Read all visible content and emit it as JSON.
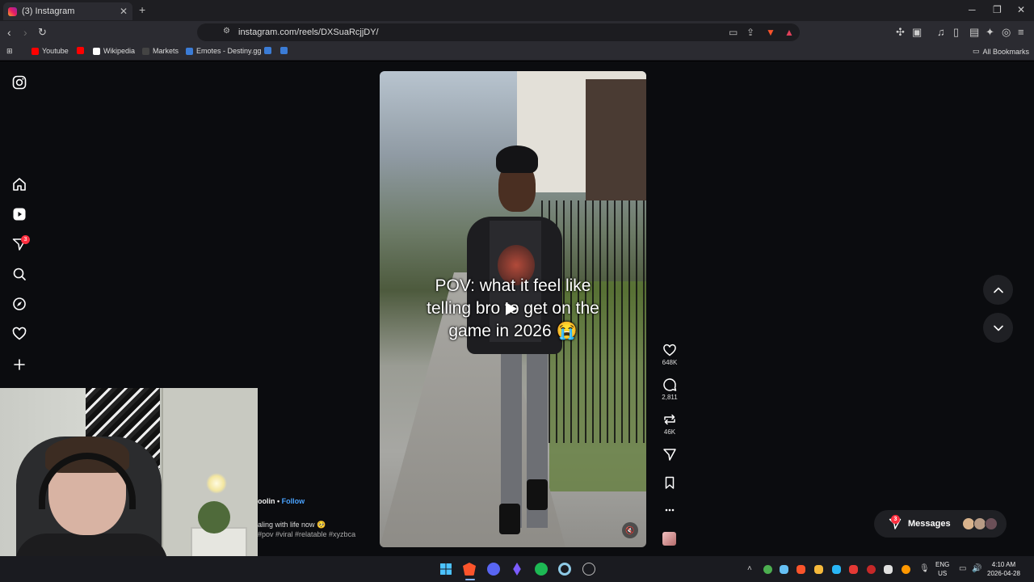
{
  "browser": {
    "tab_title": "(3) Instagram",
    "tab_close": "✕",
    "new_tab": "+",
    "url": "instagram.com/reels/DXSuaRcjjDY/",
    "window_controls": [
      "─",
      "❐",
      "✕"
    ]
  },
  "bookmarks": [
    {
      "label": "Youtube",
      "color": "#ff0000"
    },
    {
      "label": "",
      "color": "#ff0000"
    },
    {
      "label": "Wikipedia",
      "color": "#ffffff"
    },
    {
      "label": "Markets",
      "color": "#222222"
    },
    {
      "label": "Emotes - Destiny.gg",
      "color": "#3b7cd6"
    },
    {
      "label": "",
      "color": "#3b7cd6"
    },
    {
      "label": "",
      "color": "#3b7cd6"
    }
  ],
  "bookmarks_right": "All Bookmarks",
  "sidebar": {
    "notifications_badge": "3"
  },
  "reel": {
    "caption_line1": "POV: what it feel like",
    "caption_line2": "telling bro to get on the",
    "caption_line3": "game in 2026 😭",
    "mute_icon": "🔇"
  },
  "actions": {
    "likes": "648K",
    "comments": "2,811",
    "reposts": "46K"
  },
  "post": {
    "author": "oolin",
    "separator": " • ",
    "follow": "Follow",
    "description": "aling with life now 🥺",
    "tags": "#pov #viral #relatable #xyzbca"
  },
  "messages": {
    "label": "Messages",
    "badge": "3"
  },
  "taskbar": {
    "lang_line1": "ENG",
    "lang_line2": "US",
    "time": "4:10 AM",
    "date": "2026-04-28"
  }
}
